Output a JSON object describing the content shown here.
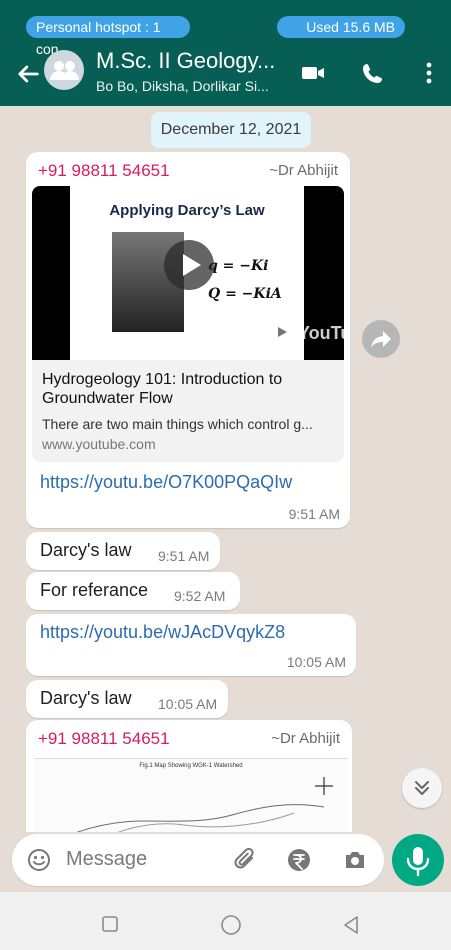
{
  "status": {
    "hotspot": "Personal hotspot : 1 con...",
    "data_usage": "Used  15.6 MB"
  },
  "header": {
    "title": "M.Sc. II Geology...",
    "subtitle": "Bo Bo, Diksha, Dorlikar Si..."
  },
  "date_chip": "December 12, 2021",
  "messages": [
    {
      "sender": "+91 98811 54651",
      "alias": "~Dr Abhijit",
      "preview": {
        "slide_title": "Applying Darcy’s Law",
        "eq1": "q = −Ki",
        "eq2": "Q = −KiA",
        "watermark": "YouTube",
        "title": "Hydrogeology 101: Introduction to Groundwater Flow",
        "description": "There are two main things which control g...",
        "domain": "www.youtube.com"
      },
      "link": "https://youtu.be/O7K00PQaQIw",
      "time": "9:51 AM"
    },
    {
      "text": "Darcy's law",
      "time": "9:51 AM"
    },
    {
      "text": "For referance",
      "time": "9:52 AM"
    },
    {
      "link": "https://youtu.be/wJAcDVqykZ8",
      "time": "10:05 AM"
    },
    {
      "text": "Darcy's law",
      "time": "10:05 AM"
    },
    {
      "sender": "+91 98811 54651",
      "alias": "~Dr Abhijit",
      "map_caption": "Fig.1 Map Showing WGK-1 Watershed"
    }
  ],
  "composer": {
    "placeholder": "Message"
  },
  "icons": {
    "back": "back-arrow-icon",
    "video": "video-call-icon",
    "call": "phone-call-icon",
    "menu": "more-vert-icon",
    "emoji": "emoji-icon",
    "attach": "attach-icon",
    "payment": "rupee-icon",
    "camera": "camera-icon",
    "mic": "mic-icon",
    "forward": "forward-icon",
    "scroll": "scroll-down-icon"
  },
  "colors": {
    "header": "#075e54",
    "chat_bg": "#e5ddd5",
    "accent": "#00a884",
    "sender": "#d81b60",
    "link": "#2b6cb0"
  }
}
